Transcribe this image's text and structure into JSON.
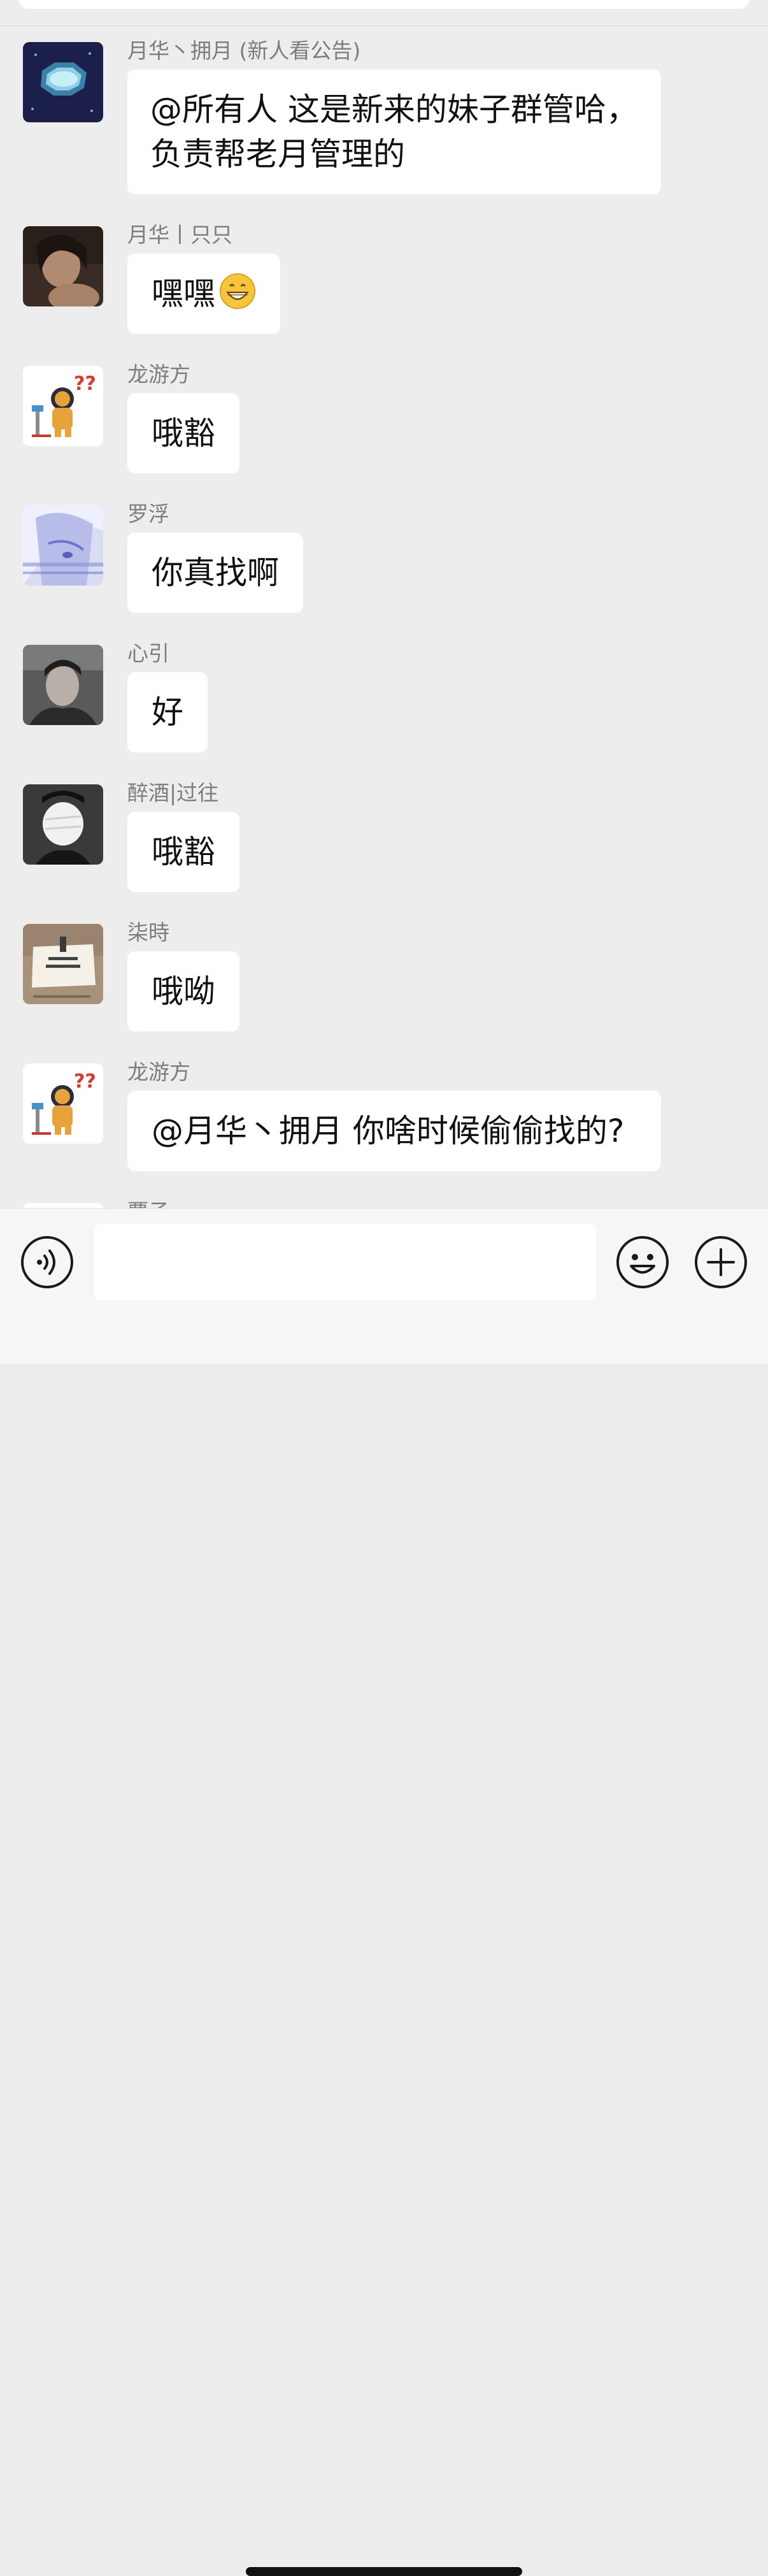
{
  "messages": [
    {
      "sender": "月华丶拥月 (新人看公告)",
      "text": "@所有人 这是新来的妹子群管哈，负责帮老月管理的",
      "avatar": "galaxy-gem-avatar"
    },
    {
      "sender": "月华丨只只",
      "text": "嘿嘿",
      "avatar": "girl-photo-avatar",
      "emoji": "grinning-face-emoji"
    },
    {
      "sender": "龙游方",
      "text": "哦豁",
      "avatar": "astronaut-avatar"
    },
    {
      "sender": "罗浮",
      "text": "你真找啊",
      "avatar": "anime-girl-avatar"
    },
    {
      "sender": "心引",
      "text": "好",
      "avatar": "man-photo-avatar"
    },
    {
      "sender": "醉酒|过往",
      "text": "哦豁",
      "avatar": "bandaged-face-avatar"
    },
    {
      "sender": "柒時",
      "text": "哦呦",
      "avatar": "sign-card-avatar"
    },
    {
      "sender": "龙游方",
      "text": "@月华丶拥月 你啥时候偷偷找的?",
      "avatar": "astronaut-avatar"
    },
    {
      "sender": "覃子",
      "avatar": "partial-avatar"
    }
  ],
  "input_bar": {
    "icons": [
      "voice-icon",
      "emoji-icon",
      "plus-icon"
    ],
    "text_value": ""
  }
}
